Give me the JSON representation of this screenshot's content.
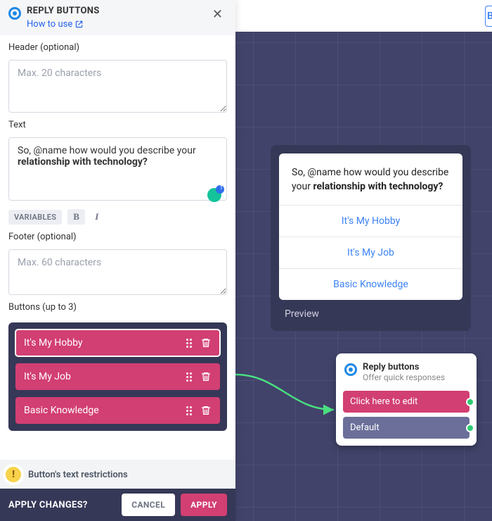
{
  "sidebar": {
    "title": "REPLY BUTTONS",
    "howto": "How to use",
    "header_label": "Header (optional)",
    "header_placeholder": "Max. 20 characters",
    "text_label": "Text",
    "text_plain": "So, @name how would you describe your ",
    "text_bold": "relationship with technology?",
    "grammarly_count": "1",
    "toolbar": {
      "variables": "VARIABLES",
      "bold": "B",
      "italic": "I"
    },
    "footer_label": "Footer (optional)",
    "footer_placeholder": "Max. 60 characters",
    "buttons_label": "Buttons (up to 3)",
    "buttons": [
      {
        "label": "It's My Hobby"
      },
      {
        "label": "It's My Job"
      },
      {
        "label": "Basic Knowledge"
      }
    ],
    "warning": "Button's text restrictions",
    "apply_q": "APPLY CHANGES?",
    "cancel": "CANCEL",
    "apply": "APPLY"
  },
  "preview": {
    "text_plain": "So, @name how would you describe your ",
    "text_bold": "relationship with technology?",
    "buttons": [
      {
        "label": "It's My Hobby"
      },
      {
        "label": "It's My Job"
      },
      {
        "label": "Basic Knowledge"
      }
    ],
    "label": "Preview"
  },
  "node": {
    "title": "Reply buttons",
    "subtitle": "Offer quick responses",
    "edit_label": "Click here to edit",
    "default_label": "Default"
  },
  "topbar": {
    "frag": "B"
  }
}
